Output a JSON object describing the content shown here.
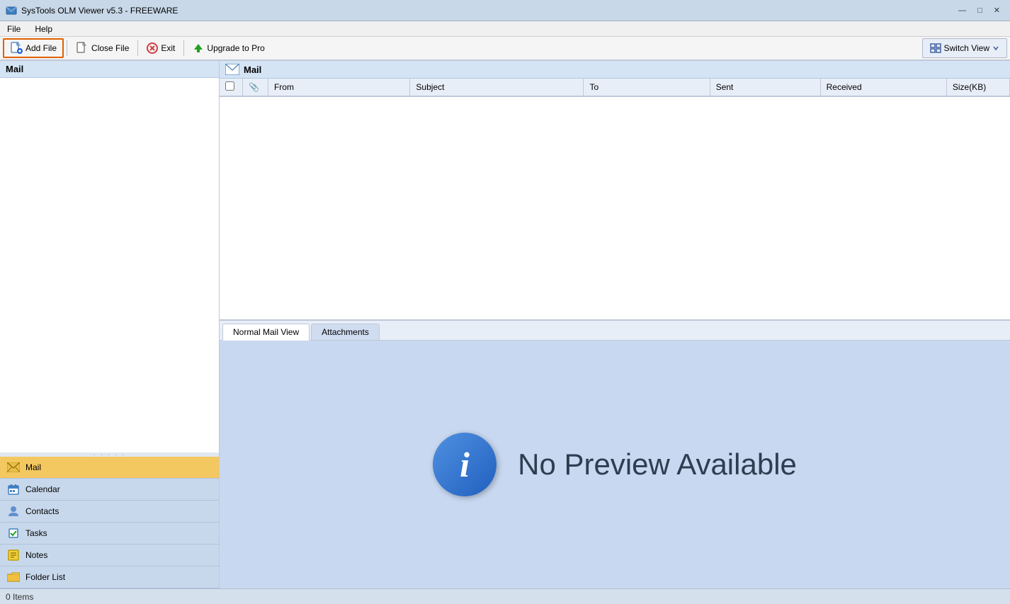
{
  "titleBar": {
    "title": "SysTools OLM Viewer v5.3 - FREEWARE",
    "controls": {
      "minimize": "—",
      "maximize": "□",
      "close": "✕"
    }
  },
  "menuBar": {
    "items": [
      {
        "id": "file",
        "label": "File"
      },
      {
        "id": "help",
        "label": "Help"
      }
    ]
  },
  "toolbar": {
    "addFile": "Add File",
    "closeFile": "Close File",
    "exit": "Exit",
    "upgradeToPro": "Upgrade to Pro",
    "switchView": "Switch View"
  },
  "sidebar": {
    "header": "Mail",
    "resizeHint": "· · · · ·"
  },
  "navItems": [
    {
      "id": "mail",
      "label": "Mail",
      "active": true
    },
    {
      "id": "calendar",
      "label": "Calendar",
      "active": false
    },
    {
      "id": "contacts",
      "label": "Contacts",
      "active": false
    },
    {
      "id": "tasks",
      "label": "Tasks",
      "active": false
    },
    {
      "id": "notes",
      "label": "Notes",
      "active": false
    },
    {
      "id": "folder-list",
      "label": "Folder List",
      "active": false
    }
  ],
  "mailPanel": {
    "title": "Mail",
    "columns": [
      {
        "id": "check",
        "label": ""
      },
      {
        "id": "attach",
        "label": "📎"
      },
      {
        "id": "from",
        "label": "From"
      },
      {
        "id": "subject",
        "label": "Subject"
      },
      {
        "id": "to",
        "label": "To"
      },
      {
        "id": "sent",
        "label": "Sent"
      },
      {
        "id": "received",
        "label": "Received"
      },
      {
        "id": "size",
        "label": "Size(KB)"
      }
    ],
    "rows": []
  },
  "bottomPanel": {
    "tabs": [
      {
        "id": "normal-mail-view",
        "label": "Normal Mail View",
        "active": true
      },
      {
        "id": "attachments",
        "label": "Attachments",
        "active": false
      }
    ],
    "preview": {
      "noPreviewText": "No Preview Available"
    }
  },
  "statusBar": {
    "itemCount": "0 Items"
  }
}
